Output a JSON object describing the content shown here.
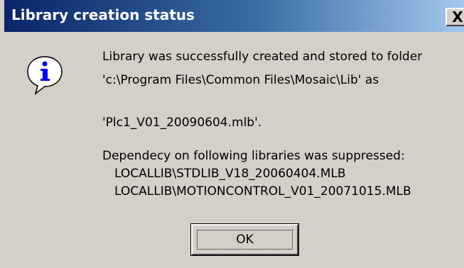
{
  "window": {
    "title": "Library creation status",
    "close_label": "X"
  },
  "message": {
    "line1": "Library was successfully created and stored to folder",
    "line2": "'c:\\Program Files\\Common Files\\Mosaic\\Lib' as",
    "line3": "'Plc1_V01_20090604.mlb'.",
    "line4": "Dependecy on following libraries was suppressed:",
    "libraries": [
      "LOCALLIB\\STDLIB_V18_20060404.MLB",
      "LOCALLIB\\MOTIONCONTROL_V01_20071015.MLB"
    ]
  },
  "buttons": {
    "ok_label": "OK"
  },
  "colors": {
    "titlebar_start": "#0a246a",
    "titlebar_end": "#a6caf0",
    "dialog_bg": "#d4d0c8",
    "icon_blue": "#0000ff"
  },
  "icon": "info-icon"
}
